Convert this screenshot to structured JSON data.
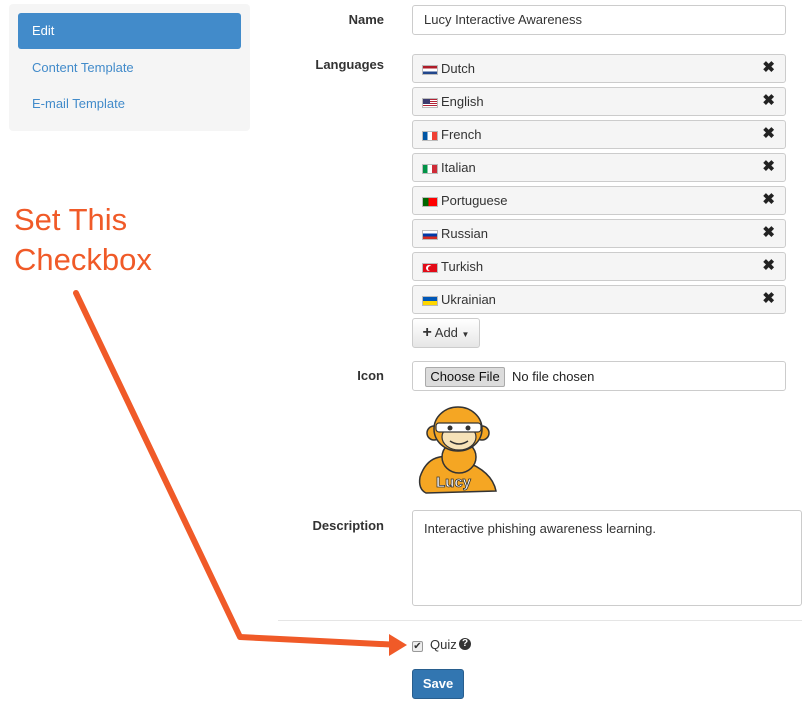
{
  "sidebar": {
    "items": [
      {
        "label": "Edit",
        "active": true
      },
      {
        "label": "Content Template",
        "active": false
      },
      {
        "label": "E-mail Template",
        "active": false
      }
    ]
  },
  "annotation": {
    "line1": "Set This",
    "line2": "Checkbox",
    "color": "#f05a28"
  },
  "form": {
    "name_label": "Name",
    "name_value": "Lucy Interactive Awareness",
    "languages_label": "Languages",
    "languages": [
      {
        "name": "Dutch",
        "flag": "nl-flag-icon"
      },
      {
        "name": "English",
        "flag": "us-flag-icon"
      },
      {
        "name": "French",
        "flag": "fr-flag-icon"
      },
      {
        "name": "Italian",
        "flag": "it-flag-icon"
      },
      {
        "name": "Portuguese",
        "flag": "pt-flag-icon"
      },
      {
        "name": "Russian",
        "flag": "ru-flag-icon"
      },
      {
        "name": "Turkish",
        "flag": "tr-flag-icon"
      },
      {
        "name": "Ukrainian",
        "flag": "ua-flag-icon"
      }
    ],
    "remove_glyph": "✖",
    "add_label": "Add",
    "add_icon": "plus-icon",
    "icon_label": "Icon",
    "choose_file_label": "Choose File",
    "no_file_text": "No file chosen",
    "logo_text": "Lucy",
    "description_label": "Description",
    "description_value": "Interactive phishing awareness learning.",
    "quiz_label": "Quiz",
    "quiz_checked": true,
    "save_label": "Save"
  },
  "colors": {
    "primary": "#428bca",
    "save": "#3276b1",
    "arrow": "#f05a28"
  }
}
